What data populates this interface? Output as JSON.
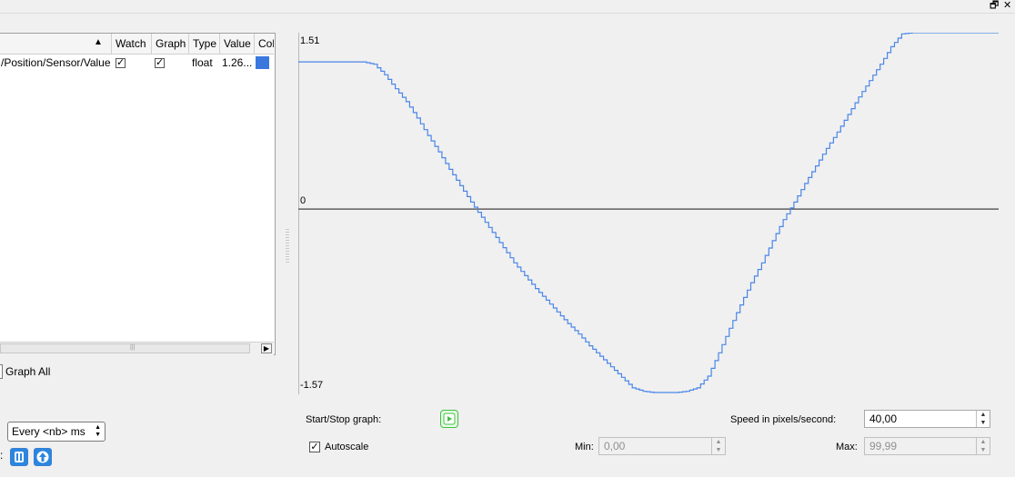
{
  "window": {
    "restore_icon": "restore-icon",
    "close_icon": "close-icon",
    "restore_glyph": "🗗",
    "close_glyph": "✕"
  },
  "table": {
    "sort_glyph": "▲",
    "columns": [
      "Watch",
      "Graph",
      "Type",
      "Value",
      "Col"
    ],
    "rows": [
      {
        "name": "/Position/Sensor/Value",
        "watch": true,
        "graph": true,
        "type": "float",
        "value": "1.26...",
        "color": "#3a78e0"
      }
    ],
    "check_glyph": "✓",
    "scroll_right_glyph": "▶"
  },
  "graph_all": {
    "label": "Graph All"
  },
  "refresh": {
    "selected": "Every <nb> ms",
    "colon": ":"
  },
  "graph": {
    "y_max_label": "1.51",
    "y_zero_label": "0",
    "y_min_label": "-1.57",
    "line_color": "#4a86e8",
    "zero_line_color": "#606060"
  },
  "controls": {
    "start_stop_label": "Start/Stop graph:",
    "speed_label": "Speed in pixels/second:",
    "speed_value": "40,00",
    "autoscale_label": "Autoscale",
    "autoscale_checked": true,
    "min_label": "Min:",
    "min_value": "0,00",
    "max_label": "Max:",
    "max_value": "99,99",
    "spin_up_glyph": "▲",
    "spin_down_glyph": "▼"
  },
  "chart_data": {
    "type": "line",
    "ylim": [
      -1.57,
      1.51
    ],
    "series": [
      {
        "values": [
          1.26,
          1.26,
          1.26,
          1.26,
          1.26,
          1.26,
          1.26,
          1.24,
          1.15,
          1.03,
          0.92,
          0.78,
          0.63,
          0.49,
          0.34,
          0.2,
          0.06,
          -0.07,
          -0.2,
          -0.33,
          -0.46,
          -0.57,
          -0.68,
          -0.78,
          -0.88,
          -0.98,
          -1.07,
          -1.17,
          -1.26,
          -1.35,
          -1.44,
          -1.53,
          -1.56,
          -1.57,
          -1.57,
          -1.57,
          -1.56,
          -1.53,
          -1.43,
          -1.23,
          -1.02,
          -0.82,
          -0.63,
          -0.46,
          -0.27,
          -0.09,
          0.06,
          0.22,
          0.37,
          0.52,
          0.66,
          0.81,
          0.96,
          1.1,
          1.24,
          1.39,
          1.5,
          1.51,
          1.51,
          1.51,
          1.51,
          1.51,
          1.51,
          1.51,
          1.51,
          1.51
        ]
      }
    ]
  }
}
